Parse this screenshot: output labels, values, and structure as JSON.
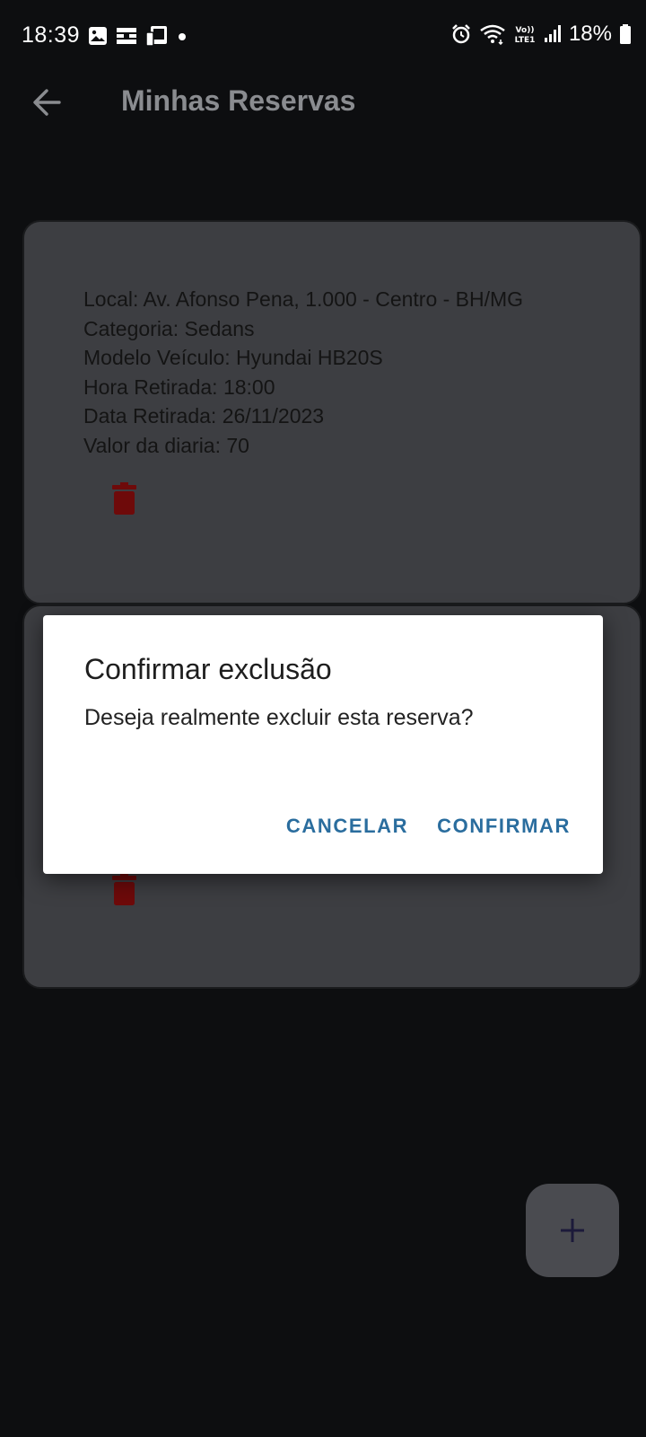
{
  "status_bar": {
    "time": "18:39",
    "battery": "18%",
    "icons": [
      "image-icon",
      "cast-icon",
      "tablet-icon",
      "dot-icon",
      "alarm-icon",
      "wifi-icon",
      "volte-icon",
      "signal-icon",
      "battery-icon"
    ]
  },
  "app_bar": {
    "title": "Minhas Reservas",
    "back_icon": "arrow-left-icon"
  },
  "cards": [
    {
      "local": "Local: Av. Afonso Pena, 1.000 - Centro - BH/MG",
      "categoria": "Categoria: Sedans",
      "modelo": "Modelo Veículo: Hyundai HB20S",
      "hora": "Hora Retirada: 18:00",
      "data": "Data Retirada: 26/11/2023",
      "valor": "Valor da diaria: 70",
      "delete_icon": "trash-icon"
    },
    {
      "delete_icon": "trash-icon"
    }
  ],
  "dialog": {
    "title": "Confirmar exclusão",
    "message": "Deseja realmente excluir esta reserva?",
    "cancel_label": "CANCELAR",
    "confirm_label": "CONFIRMAR"
  },
  "fab": {
    "icon": "plus-icon"
  },
  "colors": {
    "background": "#0d0e10",
    "card": "#3d3e42",
    "trash": "#6e0a0a",
    "dialog_button": "#2a6d9e",
    "fab": "#4a4b50",
    "fab_icon": "#1c1a3a"
  }
}
